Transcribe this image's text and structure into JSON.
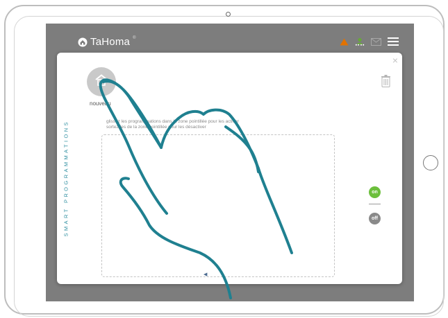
{
  "app": {
    "brand": "TaHoma",
    "brand_mark": "®"
  },
  "topbar": {
    "icons": [
      "alert-icon",
      "user-network-icon",
      "mail-icon",
      "menu-icon"
    ],
    "alert_color": "#e27200",
    "network_color": "#67a83a"
  },
  "modal": {
    "close_symbol": "×",
    "new_label": "nouveau",
    "instructions": [
      "glissez les programmations dans la zone pointillée pour les activer",
      "sortez-les de la zone pointillée pour les désactiver"
    ],
    "section_title": "SMART PROGRAMMATIONS",
    "toggle_on": "on",
    "toggle_off": "off",
    "scroll_arrow": "◀"
  },
  "colors": {
    "accent": "#2e8ea0",
    "on": "#6cbf3c",
    "off": "#8a8a8a",
    "hand_stroke": "#1f8090"
  }
}
